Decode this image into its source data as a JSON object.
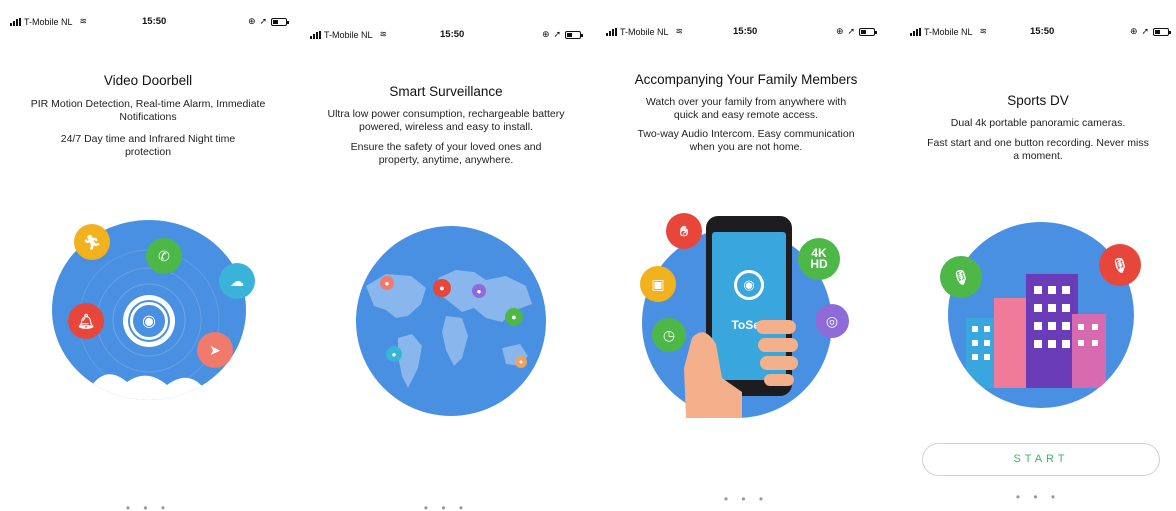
{
  "status_bar": {
    "carrier": "T-Mobile NL",
    "time": "15:50"
  },
  "screens": [
    {
      "title": "Video Doorbell",
      "paragraphs": [
        "PIR Motion Detection, Real-time Alarm, Immediate Notifications",
        "24/7 Day time and Infrared Night time protection"
      ],
      "pagination": "• • •"
    },
    {
      "title": "Smart Surveillance",
      "paragraphs": [
        "Ultra low power consumption, rechargeable battery powered, wireless and easy to install.",
        "Ensure the safety of your loved ones and property, anytime, anywhere."
      ],
      "pagination": "• • •"
    },
    {
      "title": "Accompanying Your Family Members",
      "paragraphs": [
        "Watch over your family from anywhere with quick and easy remote access.",
        "Two-way Audio Intercom. Easy communication when you are not home."
      ],
      "phone_app_name": "ToSee",
      "badge_4k": "4K",
      "badge_hd": "HD",
      "pagination": "• • •"
    },
    {
      "title": "Sports DV",
      "paragraphs": [
        "Dual 4k portable panoramic cameras.",
        "Fast start and one button recording. Never miss a moment."
      ],
      "start_button": "START",
      "pagination": "• • •"
    }
  ],
  "colors": {
    "circle_blue": "#4a90e2",
    "start_green": "#3cb371"
  }
}
